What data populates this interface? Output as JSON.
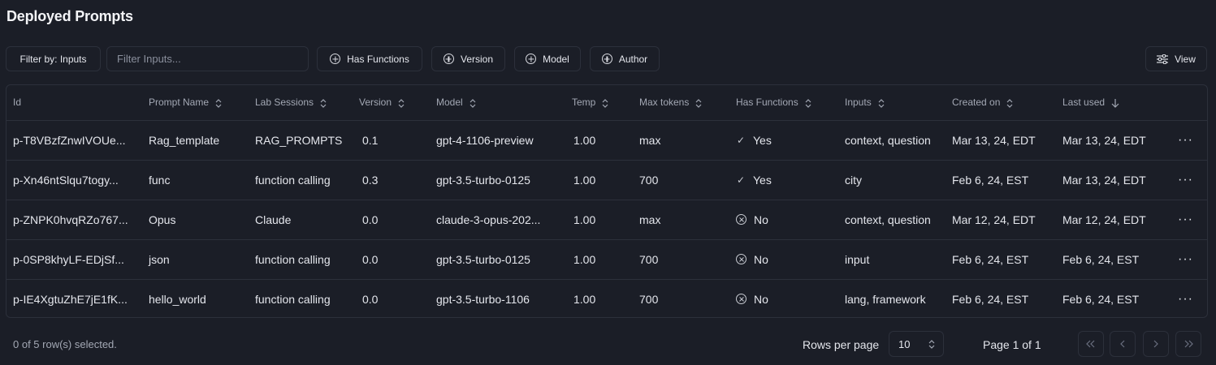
{
  "page": {
    "title": "Deployed Prompts"
  },
  "toolbar": {
    "filter_label": "Filter by: Inputs",
    "filter_placeholder": "Filter Inputs...",
    "filter_value": "",
    "chips": {
      "has_functions": "Has Functions",
      "version": "Version",
      "model": "Model",
      "author": "Author"
    },
    "view_label": "View"
  },
  "table": {
    "columns": {
      "id": "Id",
      "prompt_name": "Prompt Name",
      "lab_sessions": "Lab Sessions",
      "version": "Version",
      "model": "Model",
      "temp": "Temp",
      "max_tokens": "Max tokens",
      "has_functions": "Has Functions",
      "inputs": "Inputs",
      "created_on": "Created on",
      "last_used": "Last used"
    },
    "rows": [
      {
        "id": "p-T8VBzfZnwIVOUe...",
        "prompt_name": "Rag_template",
        "lab_session": "RAG_PROMPTS",
        "version": "0.1",
        "model": "gpt-4-1106-preview",
        "temp": "1.00",
        "max_tokens": "max",
        "has_functions": "Yes",
        "inputs": "context, question",
        "created_on": "Mar 13, 24, EDT",
        "last_used": "Mar 13, 24, EDT"
      },
      {
        "id": "p-Xn46ntSlqu7togy...",
        "prompt_name": "func",
        "lab_session": "function calling",
        "version": "0.3",
        "model": "gpt-3.5-turbo-0125",
        "temp": "1.00",
        "max_tokens": "700",
        "has_functions": "Yes",
        "inputs": "city",
        "created_on": "Feb 6, 24, EST",
        "last_used": "Mar 13, 24, EDT"
      },
      {
        "id": "p-ZNPK0hvqRZo767...",
        "prompt_name": "Opus",
        "lab_session": "Claude",
        "version": "0.0",
        "model": "claude-3-opus-202...",
        "temp": "1.00",
        "max_tokens": "max",
        "has_functions": "No",
        "inputs": "context, question",
        "created_on": "Mar 12, 24, EDT",
        "last_used": "Mar 12, 24, EDT"
      },
      {
        "id": "p-0SP8khyLF-EDjSf...",
        "prompt_name": "json",
        "lab_session": "function calling",
        "version": "0.0",
        "model": "gpt-3.5-turbo-0125",
        "temp": "1.00",
        "max_tokens": "700",
        "has_functions": "No",
        "inputs": "input",
        "created_on": "Feb 6, 24, EST",
        "last_used": "Feb 6, 24, EST"
      },
      {
        "id": "p-IE4XgtuZhE7jE1fK...",
        "prompt_name": "hello_world",
        "lab_session": "function calling",
        "version": "0.0",
        "model": "gpt-3.5-turbo-1106",
        "temp": "1.00",
        "max_tokens": "700",
        "has_functions": "No",
        "inputs": "lang, framework",
        "created_on": "Feb 6, 24, EST",
        "last_used": "Feb 6, 24, EST"
      }
    ],
    "row_actions_icon": "more-horizontal-icon"
  },
  "footer": {
    "selected_info": "0 of 5 row(s) selected.",
    "rows_per_page_label": "Rows per page",
    "rows_per_page_value": "10",
    "page_info": "Page 1 of 1"
  },
  "icons": {
    "chip": "plus-circle-icon",
    "view": "sliders-icon",
    "sort": "chevrons-up-down-icon",
    "sort_active": "arrow-down-icon",
    "yes": "check-icon",
    "no": "x-circle-icon",
    "pager": [
      "chevrons-left-icon",
      "chevron-left-icon",
      "chevron-right-icon",
      "chevrons-right-icon"
    ]
  },
  "colors": {
    "background": "#1b1e27",
    "border": "#2c303b",
    "text": "#e4e6ec",
    "muted_text": "#a3a8b4"
  }
}
